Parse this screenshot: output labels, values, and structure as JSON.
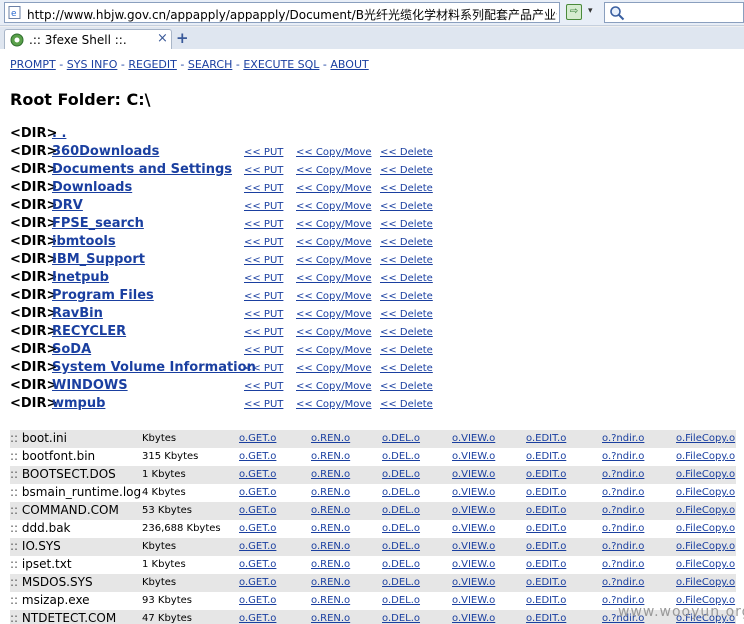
{
  "browser": {
    "url": "http://www.hbjw.gov.cn/appapply/appapply/Document/B光纤光缆化学材料系列配套产品产业化",
    "tab_label": ".:: 3fexe Shell ::.",
    "close_glyph": "×",
    "new_tab_glyph": "+",
    "refresh_glyph": "⇨",
    "dropdown_glyph": "▾"
  },
  "nav": {
    "items": [
      "PROMPT",
      "SYS INFO",
      "REGEDIT",
      "SEARCH",
      "EXECUTE SQL",
      "ABOUT"
    ],
    "separator": " - "
  },
  "root_folder": "Root Folder: C:\\",
  "dir_tag": "<DIR>",
  "parent_dir": ". .",
  "dir_actions": {
    "put": "<< PUT",
    "copy": "<< Copy/Move",
    "delete": "<< Delete"
  },
  "directories": [
    "360Downloads",
    "Documents and Settings",
    "Downloads",
    "DRV",
    "FPSE_search",
    "ibmtools",
    "IBM_Support",
    "Inetpub",
    "Program Files",
    "RavBin",
    "RECYCLER",
    "SoDA",
    "System Volume Information",
    "WINDOWS",
    "wmpub"
  ],
  "file_prefix": ":: ",
  "file_actions": [
    "o.GET.o",
    "o.REN.o",
    "o.DEL.o",
    "o.VIEW.o",
    "o.EDIT.o",
    "o.?ndir.o",
    "o.FileCopy.o"
  ],
  "files": [
    {
      "name": "boot.ini",
      "size": "Kbytes"
    },
    {
      "name": "bootfont.bin",
      "size": "315 Kbytes"
    },
    {
      "name": "BOOTSECT.DOS",
      "size": "1 Kbytes"
    },
    {
      "name": "bsmain_runtime.log",
      "size": "4 Kbytes"
    },
    {
      "name": "COMMAND.COM",
      "size": "53 Kbytes"
    },
    {
      "name": "ddd.bak",
      "size": "236,688 Kbytes"
    },
    {
      "name": "IO.SYS",
      "size": "Kbytes"
    },
    {
      "name": "ipset.txt",
      "size": "1 Kbytes"
    },
    {
      "name": "MSDOS.SYS",
      "size": "Kbytes"
    },
    {
      "name": "msizap.exe",
      "size": "93 Kbytes"
    },
    {
      "name": "NTDETECT.COM",
      "size": "47 Kbytes"
    }
  ],
  "watermark": "www.wooyun.org",
  "colors": {
    "link": "#1a3fa0",
    "row_alt": "#e6e6e6"
  }
}
